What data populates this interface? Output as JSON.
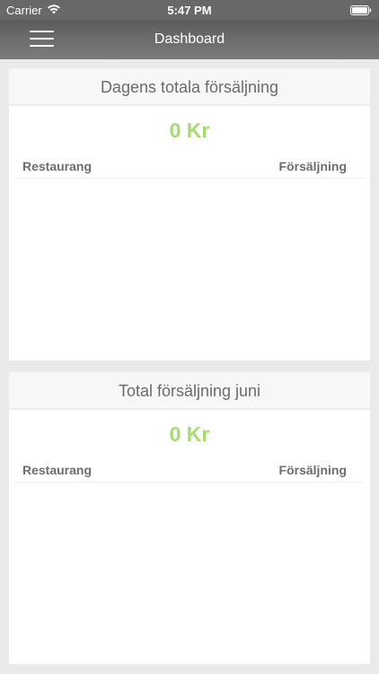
{
  "status_bar": {
    "carrier": "Carrier",
    "time": "5:47 PM"
  },
  "nav": {
    "title": "Dashboard",
    "menu_icon": "hamburger-menu-icon"
  },
  "cards": [
    {
      "title": "Dagens totala försäljning",
      "amount": "0 Kr",
      "columns": [
        "Restaurang",
        "Försäljning"
      ],
      "rows": []
    },
    {
      "title": "Total försäljning juni",
      "amount": "0 Kr",
      "columns": [
        "Restaurang",
        "Försäljning"
      ],
      "rows": []
    }
  ],
  "colors": {
    "accent_amount": "#a6db72",
    "nav_background": "#6e6e6e"
  }
}
